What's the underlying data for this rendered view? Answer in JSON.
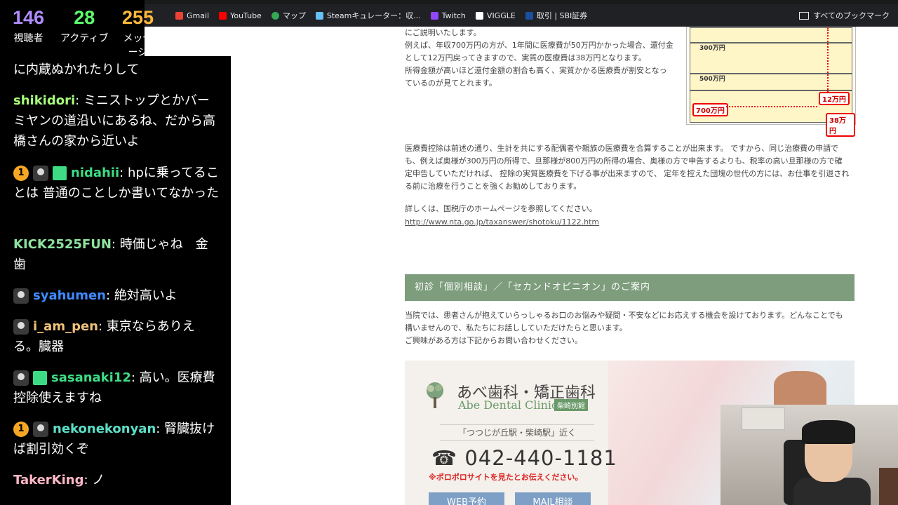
{
  "stats": {
    "viewers": {
      "value": "146",
      "label": "視聴者",
      "color": "#b08cff"
    },
    "active": {
      "value": "28",
      "label": "アクティブ",
      "color": "#5cff6b"
    },
    "messages": {
      "value": "255",
      "label": "メッセージ",
      "color": "#ffb93b"
    }
  },
  "bookmarks": {
    "items": [
      {
        "label": "Gmail",
        "icon": "gmail-icon"
      },
      {
        "label": "YouTube",
        "icon": "youtube-icon"
      },
      {
        "label": "マップ",
        "icon": "maps-icon"
      },
      {
        "label": "Steamキュレーター：収...",
        "icon": "steam-icon"
      },
      {
        "label": "Twitch",
        "icon": "twitch-icon"
      },
      {
        "label": "VIGGLE",
        "icon": "viggle-icon"
      },
      {
        "label": "取引 | SBI証券",
        "icon": "sbi-icon"
      }
    ],
    "all_label": "すべてのブックマーク"
  },
  "chat": [
    {
      "user": "",
      "color": "#ffffff",
      "text": "に内蔵ぬかれたりして",
      "badges": []
    },
    {
      "user": "shikidori",
      "color": "#a7ff7a",
      "text": "ミニストップとかバーミヤンの道沿いにあるね、だから高橋さんの家から近いよ",
      "badges": []
    },
    {
      "user": "nidahii",
      "color": "#3ddc84",
      "text": "hpに乗ってることは 普通のことしか書いてなかった",
      "badges": [
        "1",
        "avatar",
        "gift"
      ]
    },
    {
      "user": "KICK2525FUN",
      "color": "#8fe3a0",
      "text": "時価じゃね　金歯",
      "badges": []
    },
    {
      "user": "syahumen",
      "color": "#3d8bff",
      "text": "絶対高いよ",
      "badges": [
        "avatar"
      ]
    },
    {
      "user": "i_am_pen",
      "color": "#f0c27b",
      "text": "東京ならありえる。臓器",
      "badges": [
        "avatar"
      ]
    },
    {
      "user": "sasanaki12",
      "color": "#3ddc84",
      "text": "高い。医療費控除使えますね",
      "badges": [
        "avatar",
        "gift"
      ]
    },
    {
      "user": "nekonekonyan",
      "color": "#5ce0c8",
      "text": "腎臓抜けば割引効くぞ",
      "badges": [
        "1",
        "avatar"
      ]
    },
    {
      "user": "TakerKing",
      "color": "#ffb6c8",
      "text": "ノ",
      "badges": []
    }
  ],
  "page": {
    "intro_lines": [
      "にご説明いたします。",
      "例えば、年収700万円の方が、1年間に医療費が50万円かかった場合、還付金",
      "として12万円戻ってきますので、実質の医療費は38万円となります。",
      "所得金額が高いほど還付金額の割合も高く、実質かかる医療費が割安となっ",
      "ているのが見てとれます。"
    ],
    "table": {
      "income_labels": [
        "300万円",
        "500万円",
        "700万円"
      ],
      "refund_label": "12万円",
      "net_label": "38万円"
    },
    "para2_lines": [
      "医療費控除は前述の通り、生計を共にする配偶者や親族の医療費を合算することが出来ます。 ですから、同じ治療費の申請で",
      "も、例えば奥様が300万円の所得で、旦那様が800万円の所得の場合、奥様の方で申告するよりも、税率の高い旦那様の方で確",
      "定申告していただければ、 控除の実質医療費を下げる事が出来ますので、 定年を控えた団塊の世代の方には、お仕事を引退され",
      "る前に治療を行うことを強くお勧めしております。"
    ],
    "detail_text": "詳しくは、国税庁のホームページを参照してください。",
    "link": "http://www.nta.go.jp/taxanswer/shotoku/1122.htm",
    "section_title": "初診「個別相談」／「セカンドオピニオン」のご案内",
    "para3_lines": [
      "当院では、患者さんが抱えていらっしゃるお口のお悩みや疑問・不安などにお応えする機会を設けております。どんなことでも",
      "構いませんので、私たちにお話ししていただけたらと思います。",
      "ご興味がある方は下記からお問い合わせください。"
    ],
    "banner": {
      "clinic_jp": "あべ歯科・矯正歯科",
      "clinic_en": "Abe Dental Clinic",
      "branch": "柴崎別館",
      "near": "「つつじが丘駅・柴崎駅」近く",
      "phone": "042-440-1181",
      "note": "※ポロポロサイトを見たとお伝えください。",
      "btn_web": "WEB予約",
      "btn_mail": "MAIL相談"
    }
  }
}
